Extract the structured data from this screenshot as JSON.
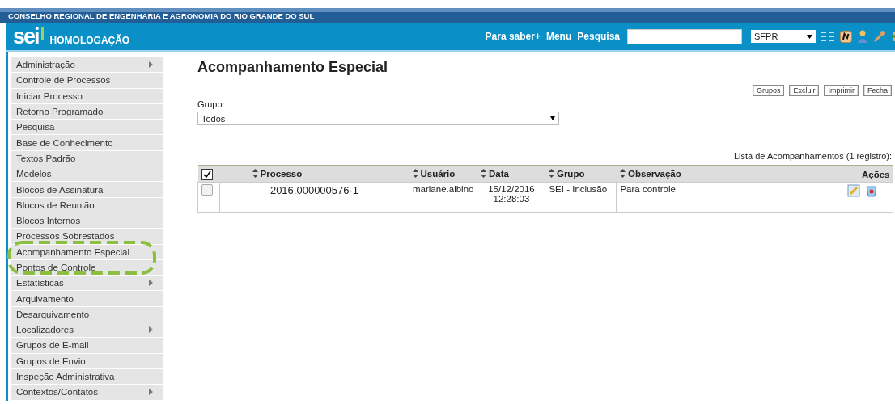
{
  "org_title": "CONSELHO REGIONAL DE ENGENHARIA E AGRONOMIA DO RIO GRANDE DO SUL",
  "logo": {
    "text": "sei",
    "environment": "HOMOLOGAÇÃO"
  },
  "top_links": [
    "Para saber+",
    "Menu",
    "Pesquisa"
  ],
  "unit_select": {
    "value": "SFPR"
  },
  "sidebar": {
    "items": [
      {
        "label": "Administração",
        "has_submenu": true
      },
      {
        "label": "Controle de Processos",
        "has_submenu": false
      },
      {
        "label": "Iniciar Processo",
        "has_submenu": false
      },
      {
        "label": "Retorno Programado",
        "has_submenu": false
      },
      {
        "label": "Pesquisa",
        "has_submenu": false
      },
      {
        "label": "Base de Conhecimento",
        "has_submenu": false
      },
      {
        "label": "Textos Padrão",
        "has_submenu": false
      },
      {
        "label": "Modelos",
        "has_submenu": false
      },
      {
        "label": "Blocos de Assinatura",
        "has_submenu": false
      },
      {
        "label": "Blocos de Reunião",
        "has_submenu": false
      },
      {
        "label": "Blocos Internos",
        "has_submenu": false
      },
      {
        "label": "Processos Sobrestados",
        "has_submenu": false
      },
      {
        "label": "Acompanhamento Especial",
        "has_submenu": false
      },
      {
        "label": "Pontos de Controle",
        "has_submenu": false
      },
      {
        "label": "Estatísticas",
        "has_submenu": true
      },
      {
        "label": "Arquivamento",
        "has_submenu": false
      },
      {
        "label": "Desarquivamento",
        "has_submenu": false
      },
      {
        "label": "Localizadores",
        "has_submenu": true
      },
      {
        "label": "Grupos de E-mail",
        "has_submenu": false
      },
      {
        "label": "Grupos de Envio",
        "has_submenu": false
      },
      {
        "label": "Inspeção Administrativa",
        "has_submenu": false
      },
      {
        "label": "Contextos/Contatos",
        "has_submenu": true
      }
    ]
  },
  "page_title": "Acompanhamento Especial",
  "buttons": [
    "Grupos",
    "Excluir",
    "Imprimir",
    "Fecha"
  ],
  "group_filter": {
    "label": "Grupo:",
    "value": "Todos"
  },
  "table": {
    "caption": "Lista de Acompanhamentos (1 registro):",
    "header_checked": true,
    "columns": [
      "Processo",
      "Usuário",
      "Data",
      "Grupo",
      "Observação",
      "Ações"
    ],
    "rows": [
      {
        "checked": false,
        "cells": [
          "2016.000000576-1",
          "mariane.albino",
          "15/12/2016 12:28:03",
          "SEI - Inclusão",
          "Para controle"
        ]
      }
    ]
  }
}
